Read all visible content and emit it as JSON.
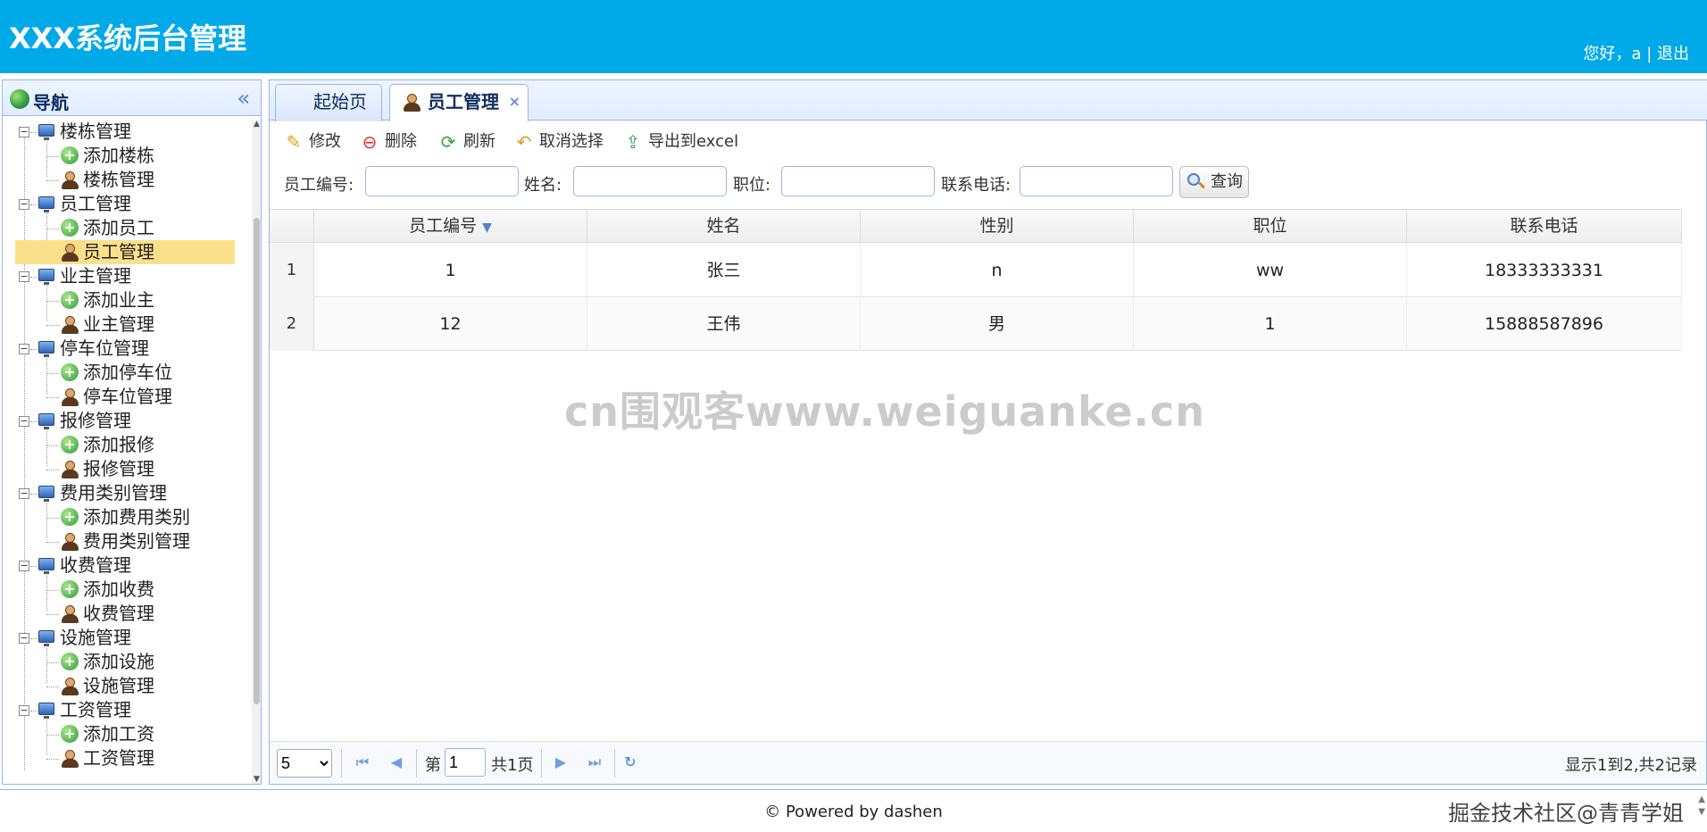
{
  "header": {
    "title": "XXX系统后台管理",
    "greeting": "您好，a",
    "separator": "|",
    "logout": "退出"
  },
  "sidebar": {
    "title": "导航",
    "collapse_icon": "double-chevron-left-icon",
    "groups": [
      {
        "label": "楼栋管理",
        "items": [
          "添加楼栋",
          "楼栋管理"
        ]
      },
      {
        "label": "员工管理",
        "items": [
          "添加员工",
          "员工管理"
        ]
      },
      {
        "label": "业主管理",
        "items": [
          "添加业主",
          "业主管理"
        ]
      },
      {
        "label": "停车位管理",
        "items": [
          "添加停车位",
          "停车位管理"
        ]
      },
      {
        "label": "报修管理",
        "items": [
          "添加报修",
          "报修管理"
        ]
      },
      {
        "label": "费用类别管理",
        "items": [
          "添加费用类别",
          "费用类别管理"
        ]
      },
      {
        "label": "收费管理",
        "items": [
          "添加收费",
          "收费管理"
        ]
      },
      {
        "label": "设施管理",
        "items": [
          "添加设施",
          "设施管理"
        ]
      },
      {
        "label": "工资管理",
        "items": [
          "添加工资",
          "工资管理"
        ]
      }
    ],
    "selected": "员工管理"
  },
  "tabs": [
    {
      "label": "起始页",
      "active": false
    },
    {
      "label": "员工管理",
      "active": true,
      "closable": true
    }
  ],
  "toolbar": {
    "edit": "修改",
    "delete": "删除",
    "refresh": "刷新",
    "unselect": "取消选择",
    "export": "导出到excel"
  },
  "search": {
    "emp_no_label": "员工编号:",
    "name_label": "姓名:",
    "position_label": "职位:",
    "phone_label": "联系电话:",
    "button": "查询"
  },
  "grid": {
    "columns": [
      "员工编号",
      "姓名",
      "性别",
      "职位",
      "联系电话"
    ],
    "rows": [
      {
        "num": "1",
        "emp_no": "1",
        "name": "张三",
        "gender": "n",
        "position": "ww",
        "phone": "18333333331"
      },
      {
        "num": "2",
        "emp_no": "12",
        "name": "王伟",
        "gender": "男",
        "position": "1",
        "phone": "15888587896"
      }
    ]
  },
  "watermark": "cn围观客www.weiguanke.cn",
  "pager": {
    "page_size": "5",
    "page_prefix": "第",
    "page_value": "1",
    "page_total": "共1页",
    "info": "显示1到2,共2记录"
  },
  "footer": {
    "text": "© Powered by dashen",
    "credit": "掘金技术社区@青青学姐"
  }
}
